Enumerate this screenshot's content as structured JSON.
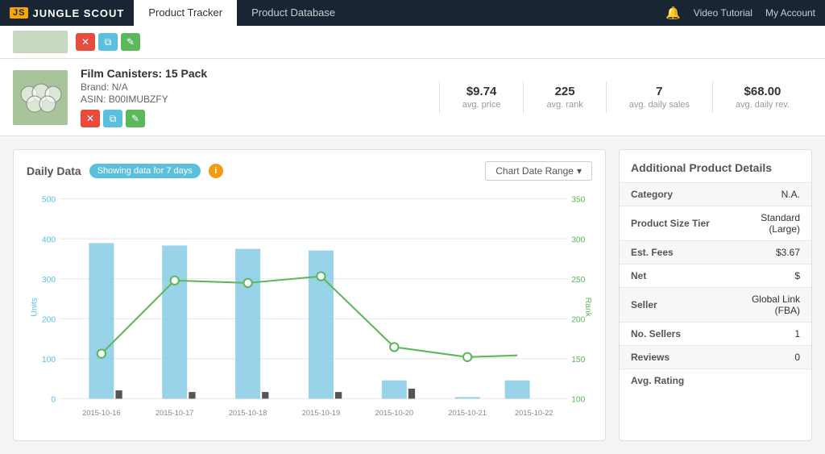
{
  "navbar": {
    "brand": "JUNGLE SCOUT",
    "brand_badge": "JS",
    "tabs": [
      {
        "label": "Product Tracker",
        "active": true
      },
      {
        "label": "Product Database",
        "active": false
      }
    ],
    "bell_icon": "bell",
    "video_tutorial": "Video Tutorial",
    "account": "My Account"
  },
  "product_top": {
    "actions": [
      {
        "label": "✕",
        "type": "red"
      },
      {
        "label": "⧉",
        "type": "blue"
      },
      {
        "label": "✎",
        "type": "green"
      }
    ]
  },
  "product": {
    "title": "Film Canisters: 15 Pack",
    "brand_label": "Brand:",
    "brand_value": "N/A",
    "asin_label": "ASIN:",
    "asin_value": "B00IMUBZFY",
    "actions": [
      {
        "label": "✕",
        "type": "red"
      },
      {
        "label": "⧉",
        "type": "blue"
      },
      {
        "label": "✎",
        "type": "green"
      }
    ],
    "stats": [
      {
        "value": "$9.74",
        "label": "avg. price"
      },
      {
        "value": "225",
        "label": "avg. rank"
      },
      {
        "value": "7",
        "label": "avg. daily sales"
      },
      {
        "value": "$68.00",
        "label": "avg. daily rev."
      }
    ]
  },
  "chart": {
    "title": "Daily Data",
    "showing_label": "Showing data for 7 days",
    "info_icon": "i",
    "date_range_btn": "Chart Date Range",
    "chevron": "▾",
    "y_left_labels": [
      "500",
      "400",
      "300",
      "200",
      "100",
      "0"
    ],
    "y_right_labels": [
      "350",
      "300",
      "250",
      "200",
      "150",
      "100"
    ],
    "y_left_title": "Units",
    "y_right_title": "Rank",
    "x_labels": [
      "2015-10-16",
      "2015-10-17",
      "2015-10-18",
      "2015-10-19",
      "2015-10-20",
      "2015-10-21",
      "2015-10-22"
    ]
  },
  "details": {
    "title": "Additional Product Details",
    "rows": [
      {
        "label": "Category",
        "value": "N.A."
      },
      {
        "label": "Product Size Tier",
        "value": "Standard (Large)"
      },
      {
        "label": "Est. Fees",
        "value": "$3.67"
      },
      {
        "label": "Net",
        "value": "$"
      },
      {
        "label": "Seller",
        "value": "Global Link (FBA)"
      },
      {
        "label": "No. Sellers",
        "value": "1"
      },
      {
        "label": "Reviews",
        "value": "0"
      },
      {
        "label": "Avg. Rating",
        "value": ""
      }
    ]
  }
}
